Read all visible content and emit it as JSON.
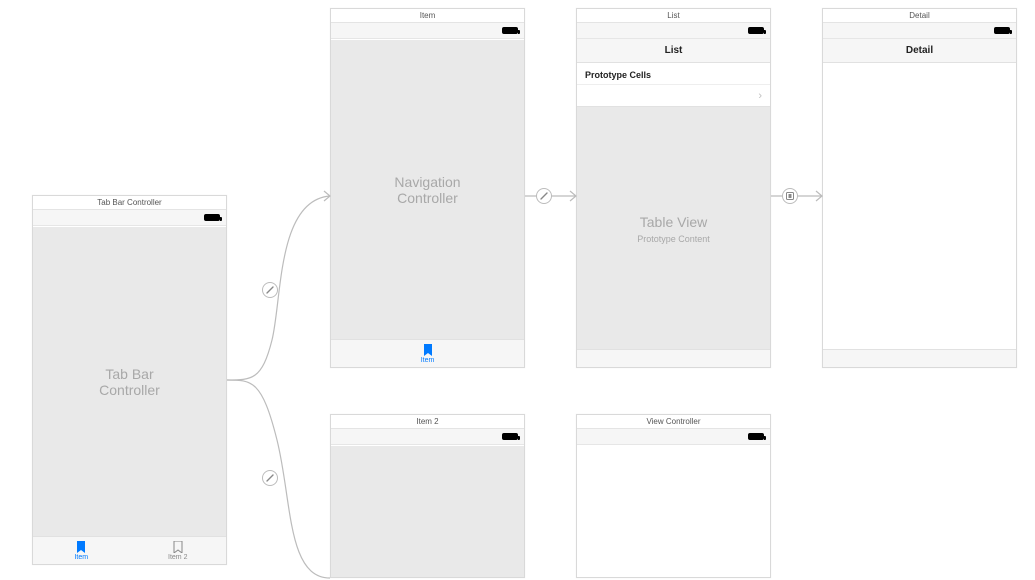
{
  "scenes": {
    "tabBar": {
      "title": "Tab Bar Controller",
      "placeholder": "Tab Bar Controller",
      "tabs": [
        {
          "label": "Item",
          "active": true
        },
        {
          "label": "Item 2",
          "active": false
        }
      ]
    },
    "item": {
      "title": "Item",
      "placeholder": "Navigation Controller",
      "tabLabel": "Item"
    },
    "list": {
      "title": "List",
      "navTitle": "List",
      "protoHeader": "Prototype Cells",
      "tablePlaceholderTitle": "Table View",
      "tablePlaceholderSub": "Prototype Content"
    },
    "detail": {
      "title": "Detail",
      "navTitle": "Detail"
    },
    "item2": {
      "title": "Item 2"
    },
    "viewController": {
      "title": "View Controller"
    }
  },
  "colors": {
    "tint": "#007aff",
    "arrow": "#bcbcbc"
  }
}
